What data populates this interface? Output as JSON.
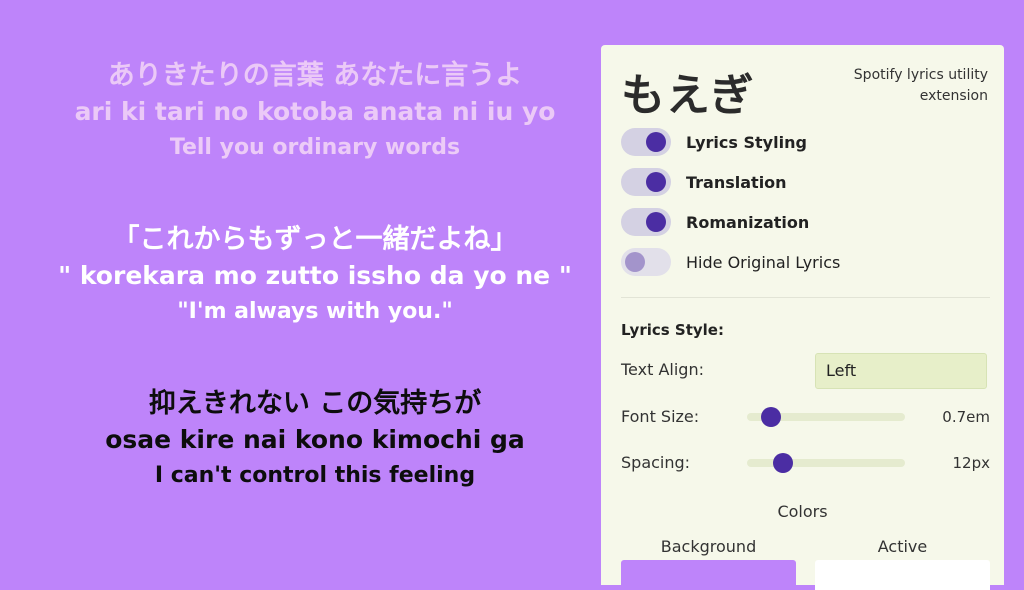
{
  "lyrics": [
    {
      "japanese": "ありきたりの言葉 あなたに言うよ",
      "romaji": "ari ki tari no kotoba anata ni iu yo",
      "translation": "Tell you ordinary words"
    },
    {
      "japanese": "「これからもずっと一緒だよね」",
      "romaji": "\" korekara mo zutto issho da yo ne \"",
      "translation": "\"I'm always with you.\""
    },
    {
      "japanese": "抑えきれない この気持ちが",
      "romaji": "osae kire nai kono kimochi ga",
      "translation": "I can't control this feeling"
    }
  ],
  "panel": {
    "brand": "もえぎ",
    "tagline": "Spotify lyrics utility extension",
    "toggles": [
      {
        "label": "Lyrics Styling",
        "on": true
      },
      {
        "label": "Translation",
        "on": true
      },
      {
        "label": "Romanization",
        "on": true
      },
      {
        "label": "Hide Original Lyrics",
        "on": false
      }
    ],
    "lyrics_style": {
      "title": "Lyrics Style:",
      "text_align_label": "Text Align:",
      "text_align_value": "Left",
      "font_size_label": "Font Size:",
      "font_size_value": "0.7em",
      "font_size_fraction": 0.15,
      "spacing_label": "Spacing:",
      "spacing_value": "12px",
      "spacing_fraction": 0.23
    },
    "colors": {
      "title": "Colors",
      "background_label": "Background",
      "background_color": "#be84fa",
      "active_label": "Active",
      "active_color": "#ffffff"
    }
  },
  "theme": {
    "page_background": "#be84fa",
    "accent": "#4b2da3",
    "panel_background": "#f6f8ea"
  }
}
